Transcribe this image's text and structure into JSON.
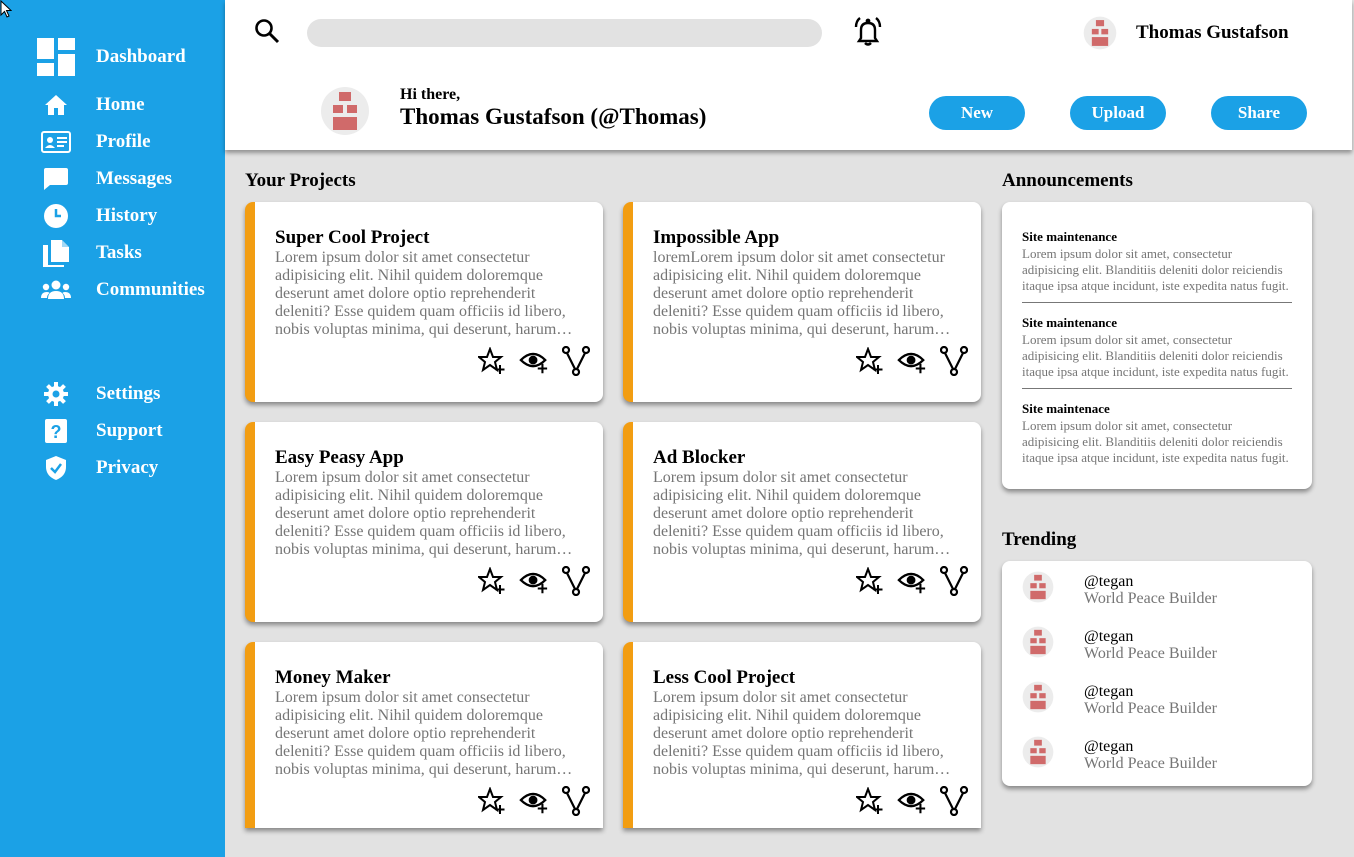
{
  "sidebar": {
    "dashboard_label": "Dashboard",
    "items": [
      {
        "label": "Home",
        "icon": "home-icon"
      },
      {
        "label": "Profile",
        "icon": "id-card-icon"
      },
      {
        "label": "Messages",
        "icon": "chat-bubble-icon"
      },
      {
        "label": "History",
        "icon": "clock-icon"
      },
      {
        "label": "Tasks",
        "icon": "documents-icon"
      },
      {
        "label": "Communities",
        "icon": "people-icon"
      }
    ],
    "bottom_items": [
      {
        "label": "Settings",
        "icon": "gear-icon"
      },
      {
        "label": "Support",
        "icon": "help-icon"
      },
      {
        "label": "Privacy",
        "icon": "shield-check-icon"
      }
    ]
  },
  "header": {
    "search_placeholder": "",
    "username": "Thomas Gustafson",
    "greeting": "Hi there,",
    "fullname": "Thomas Gustafson (@Thomas)",
    "buttons": {
      "new": "New",
      "upload": "Upload",
      "share": "Share"
    }
  },
  "projects": {
    "title": "Your Projects",
    "items": [
      {
        "title": "Super Cool Project",
        "description": "Lorem ipsum dolor sit amet consectetur adipisicing elit. Nihil quidem doloremque deserunt amet dolore optio reprehenderit deleniti? Esse quidem quam officiis id libero, nobis voluptas minima, qui deserunt, harum quas."
      },
      {
        "title": "Impossible App",
        "description": "loremLorem ipsum dolor sit amet consectetur adipisicing elit. Nihil quidem doloremque deserunt amet dolore optio reprehenderit deleniti? Esse quidem quam officiis id libero, nobis voluptas minima, qui deserunt, harum quas."
      },
      {
        "title": "Easy Peasy App",
        "description": "Lorem ipsum dolor sit amet consectetur adipisicing elit. Nihil quidem doloremque deserunt amet dolore optio reprehenderit deleniti? Esse quidem quam officiis id libero, nobis voluptas minima, qui deserunt, harum quas."
      },
      {
        "title": "Ad Blocker",
        "description": "Lorem ipsum dolor sit amet consectetur adipisicing elit. Nihil quidem doloremque deserunt amet dolore optio reprehenderit deleniti? Esse quidem quam officiis id libero, nobis voluptas minima, qui deserunt, harum quas."
      },
      {
        "title": "Money Maker",
        "description": "Lorem ipsum dolor sit amet consectetur adipisicing elit. Nihil quidem doloremque deserunt amet dolore optio reprehenderit deleniti? Esse quidem quam officiis id libero, nobis voluptas minima, qui deserunt, harum quas."
      },
      {
        "title": "Less Cool Project",
        "description": "Lorem ipsum dolor sit amet consectetur adipisicing elit. Nihil quidem doloremque deserunt amet dolore optio reprehenderit deleniti? Esse quidem quam officiis id libero, nobis voluptas minima, qui deserunt, harum quas."
      }
    ],
    "action_icons": [
      "star-plus-icon",
      "eye-plus-icon",
      "fork-icon"
    ]
  },
  "announcements": {
    "title": "Announcements",
    "items": [
      {
        "title": "Site maintenance",
        "text": "Lorem ipsum dolor sit amet, consectetur adipisicing elit. Blanditiis deleniti dolor reiciendis itaque ipsa atque incidunt, iste expedita natus fugit."
      },
      {
        "title": "Site maintenance",
        "text": "Lorem ipsum dolor sit amet, consectetur adipisicing elit. Blanditiis deleniti dolor reiciendis itaque ipsa atque incidunt, iste expedita natus fugit."
      },
      {
        "title": "Site maintenace",
        "text": "Lorem ipsum dolor sit amet, consectetur adipisicing elit. Blanditiis deleniti dolor reiciendis itaque ipsa atque incidunt, iste expedita natus fugit."
      }
    ]
  },
  "trending": {
    "title": "Trending",
    "items": [
      {
        "handle": "@tegan",
        "role": "World Peace Builder"
      },
      {
        "handle": "@tegan",
        "role": "World Peace Builder"
      },
      {
        "handle": "@tegan",
        "role": "World Peace Builder"
      },
      {
        "handle": "@tegan",
        "role": "World Peace Builder"
      }
    ]
  },
  "colors": {
    "accent": "#1ba1e6",
    "card_stripe": "#f29d12",
    "avatar": "#d06a6a",
    "background": "#e2e2e2"
  }
}
